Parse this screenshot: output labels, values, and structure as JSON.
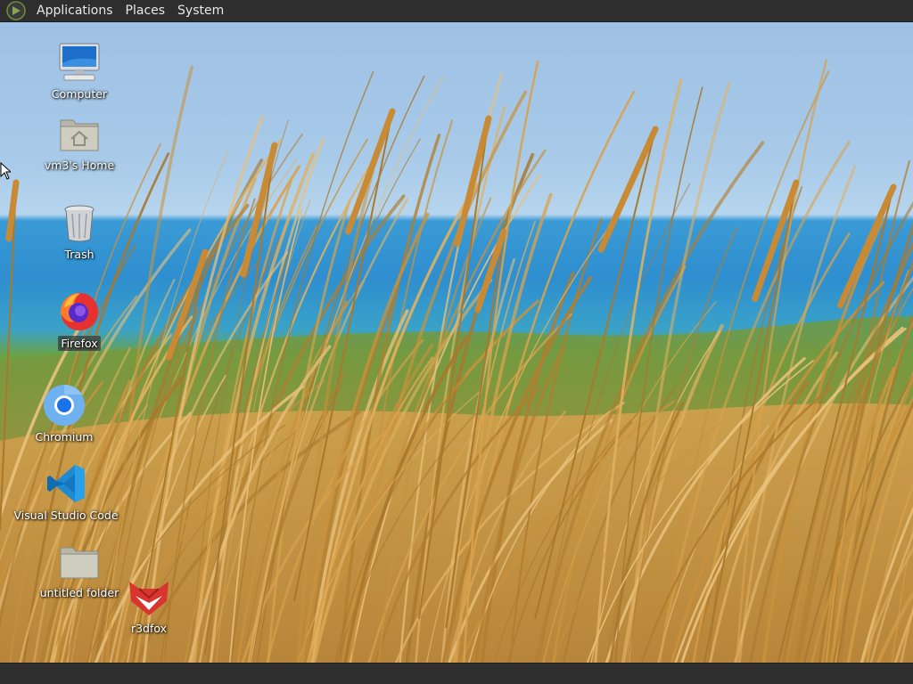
{
  "panel": {
    "menus": [
      "Applications",
      "Places",
      "System"
    ]
  },
  "desktop": {
    "icons": [
      {
        "label": "Computer",
        "icon": "computer-icon"
      },
      {
        "label": "vm3's Home",
        "icon": "home-folder-icon"
      },
      {
        "label": "Trash",
        "icon": "trash-icon"
      },
      {
        "label": "Firefox",
        "icon": "firefox-icon"
      },
      {
        "label": "Chromium",
        "icon": "chromium-icon"
      },
      {
        "label": "Visual Studio Code",
        "icon": "vscode-icon"
      },
      {
        "label": "untitled folder",
        "icon": "folder-icon"
      },
      {
        "label": "r3dfox",
        "icon": "r3dfox-icon"
      }
    ]
  },
  "colors": {
    "panel_bg": "#2e2e2e",
    "panel_text": "#e8e8e8",
    "label_text": "#ffffff"
  }
}
